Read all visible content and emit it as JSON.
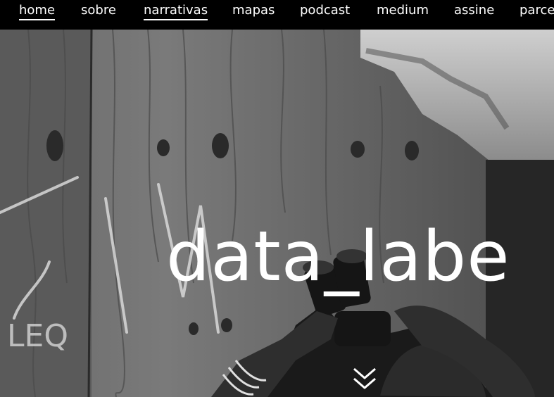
{
  "nav": {
    "items": [
      {
        "label": "home",
        "active": true
      },
      {
        "label": "sobre",
        "active": false
      },
      {
        "label": "narrativas",
        "active": true
      },
      {
        "label": "mapas",
        "active": false
      },
      {
        "label": "podcast",
        "active": false
      },
      {
        "label": "medium",
        "active": false
      },
      {
        "label": "assine",
        "active": false
      },
      {
        "label": "parce",
        "active": false
      }
    ]
  },
  "hero": {
    "logo_text": "data_labe",
    "scroll_icon": "double-chevron-down-icon",
    "photo": "black-and-white photo: person with binoculars in front of wooden wall"
  },
  "colors": {
    "nav_bg": "#000000",
    "nav_text": "#ffffff",
    "logo": "#ffffff"
  }
}
